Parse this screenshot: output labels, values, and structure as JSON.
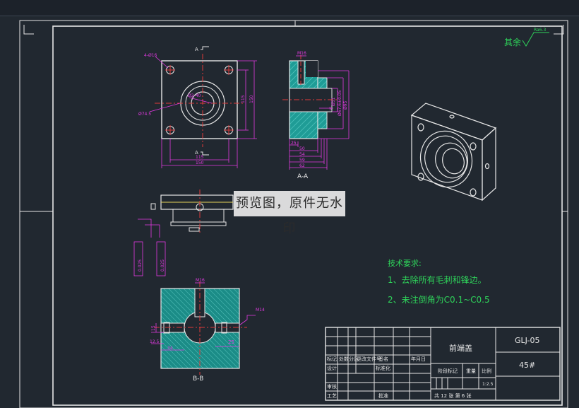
{
  "colors": {
    "background": "#212830",
    "frame": "#e6e6e6",
    "dimension": "#e23ae2",
    "centerline": "#e03a3a",
    "section_fill": "#1f9c96",
    "notes": "#2ed35a",
    "hidden": "#e6d35a"
  },
  "roughness": {
    "label": "其余",
    "value": "Ra6.3"
  },
  "front_view": {
    "holes_note": "4-Ø16",
    "dia_inner": "Ø2-40",
    "dia_outer": "Ø74.5",
    "width_inner": "115",
    "width_outer": "150",
    "height_inner": "115",
    "height_outer": "150",
    "section_mark": "A"
  },
  "section_aa": {
    "thread_label": "M16",
    "dia_labels": [
      "Ø51",
      "Ø67.6±0.05",
      "Ø95"
    ],
    "small_dim": "5",
    "bottom_dims": [
      "25",
      "50",
      "54",
      "59",
      "62"
    ],
    "title": "A-A"
  },
  "top_view": {
    "tol_left": "0.025",
    "tol_right": "0.025"
  },
  "section_bb": {
    "thread_top": "M16",
    "thread_right": "M14",
    "dim_left_vert": "15",
    "dim_small": "12.5",
    "dim_left_bottom": "34",
    "dim_right": "25",
    "title": "B-B"
  },
  "watermark": "预览图，原件无水印",
  "tech_notes": {
    "heading": "技术要求:",
    "items": [
      "1、去除所有毛刺和锋边。",
      "2、未注倒角为C0.1~C0.5"
    ]
  },
  "title_block": {
    "part_name": "前端盖",
    "drawing_no": "GLJ-05",
    "material": "45#",
    "row_labels": [
      "标记",
      "处数",
      "分区",
      "更改文件号",
      "签名",
      "年月日"
    ],
    "design": "设计",
    "standardize": "标准化",
    "review": "审核",
    "process": "工艺",
    "approve": "批准",
    "stage_mark": "阶段标记",
    "weight": "重量",
    "scale": "比例",
    "scale_value": "1:2.5",
    "sheets": "共 12 张  第 6 张"
  }
}
